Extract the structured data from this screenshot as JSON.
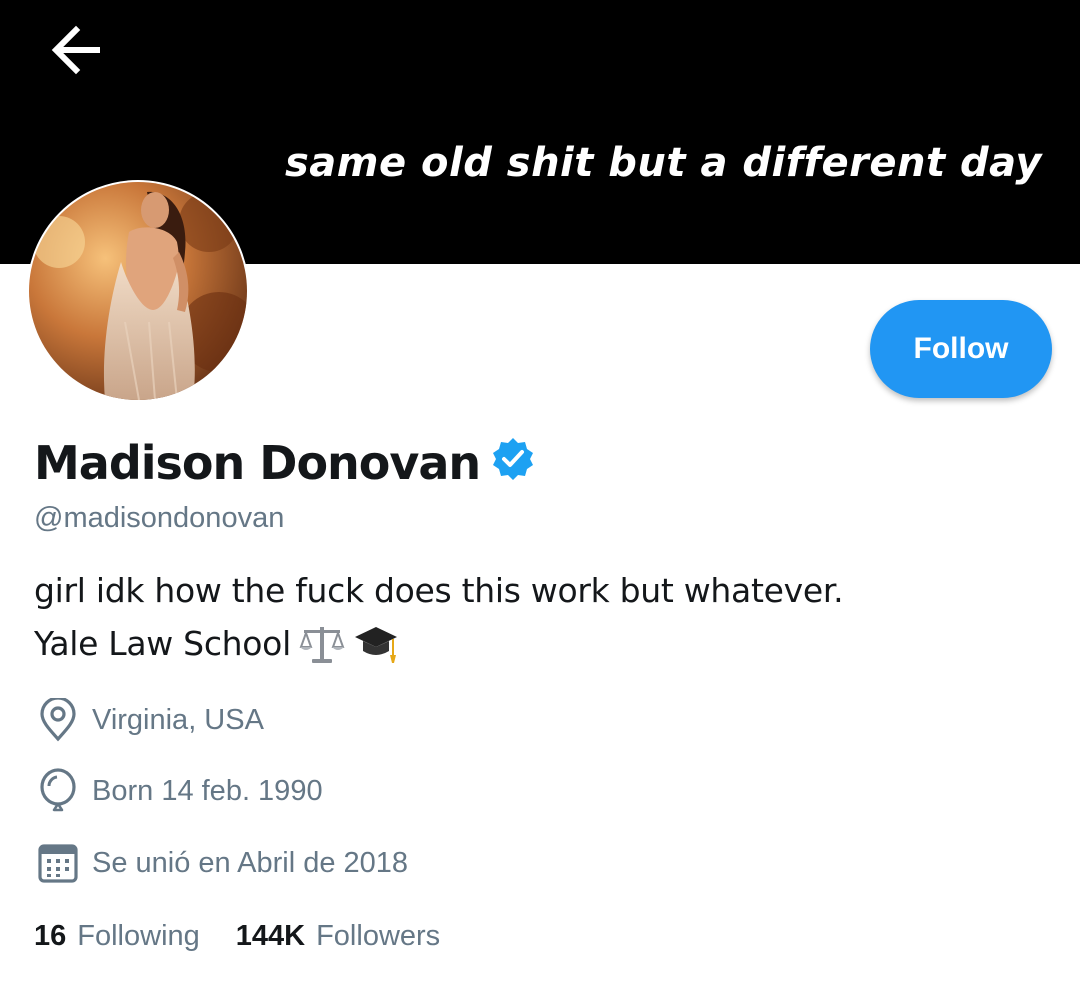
{
  "header": {
    "back_icon": "arrow-left-icon",
    "banner_text": "same old shit but a different day",
    "banner_color": "#000000"
  },
  "profile": {
    "display_name": "Madison Donovan",
    "verified": true,
    "verified_color": "#1da1f2",
    "handle": "@madisondonovan",
    "bio_line_1": "girl idk how the fuck does this work but whatever.",
    "bio_line_2": "Yale Law School",
    "bio_emojis": [
      "balance-scale-icon",
      "graduation-cap-icon"
    ]
  },
  "actions": {
    "follow_label": "Follow",
    "accent_color": "#2196f3"
  },
  "details": {
    "location": "Virginia, USA",
    "location_icon": "location-pin-icon",
    "birthday": "Born 14 feb. 1990",
    "birthday_icon": "balloon-icon",
    "joined": "Se unió en Abril de 2018",
    "joined_icon": "calendar-icon"
  },
  "stats": {
    "following_count": "16",
    "following_label": "Following",
    "followers_count": "144K",
    "followers_label": "Followers"
  }
}
